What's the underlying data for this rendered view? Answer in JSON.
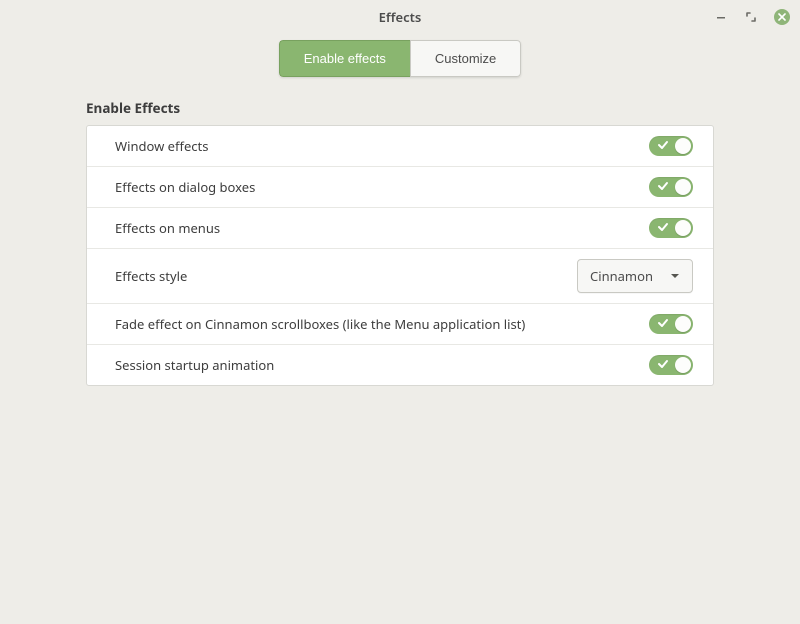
{
  "window": {
    "title": "Effects"
  },
  "tabs": [
    {
      "label": "Enable effects",
      "active": true
    },
    {
      "label": "Customize",
      "active": false
    }
  ],
  "section_title": "Enable Effects",
  "rows": [
    {
      "label": "Window effects",
      "type": "toggle",
      "value": true
    },
    {
      "label": "Effects on dialog boxes",
      "type": "toggle",
      "value": true
    },
    {
      "label": "Effects on menus",
      "type": "toggle",
      "value": true
    },
    {
      "label": "Effects style",
      "type": "select",
      "value": "Cinnamon"
    },
    {
      "label": "Fade effect on Cinnamon scrollboxes (like the Menu application list)",
      "type": "toggle",
      "value": true
    },
    {
      "label": "Session startup animation",
      "type": "toggle",
      "value": true
    }
  ],
  "colors": {
    "accent": "#8ab670",
    "bg": "#eeede8"
  }
}
